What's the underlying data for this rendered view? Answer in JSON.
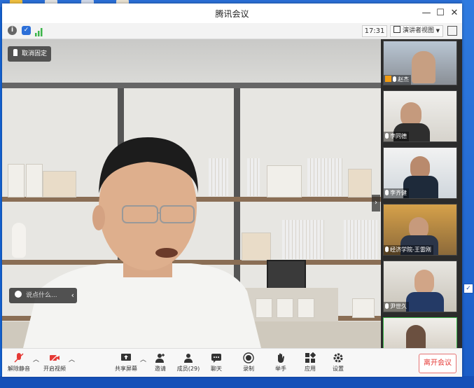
{
  "window": {
    "title": "腾讯会议"
  },
  "infobar": {
    "time": "17:31",
    "view_mode": "演讲者视图"
  },
  "stage": {
    "cancel_pin_label": "取消固定",
    "chat_placeholder": "说点什么..."
  },
  "participants": [
    {
      "name": "赵杰"
    },
    {
      "name": "李同德"
    },
    {
      "name": "李齐健"
    },
    {
      "name": "经济学院-王雷刚"
    },
    {
      "name": "尹世久"
    },
    {
      "name": ""
    }
  ],
  "toolbar": {
    "unmute_label": "解除静音",
    "video_label": "开启视频",
    "share_label": "共享屏幕",
    "invite_label": "邀请",
    "members_label": "成员(29)",
    "chat_label": "聊天",
    "record_label": "录制",
    "raise_hand_label": "举手",
    "apps_label": "应用",
    "settings_label": "设置",
    "leave_label": "离开会议"
  },
  "colors": {
    "accent": "#1565d8",
    "danger": "#e53935",
    "mute_red": "#e53935"
  },
  "icons": [
    "info-icon",
    "shield-icon",
    "signal-icon",
    "pin-icon",
    "mic-off-icon",
    "video-off-icon",
    "share-icon",
    "invite-icon",
    "members-icon",
    "chat-icon",
    "record-icon",
    "hand-icon",
    "apps-icon",
    "settings-icon"
  ]
}
